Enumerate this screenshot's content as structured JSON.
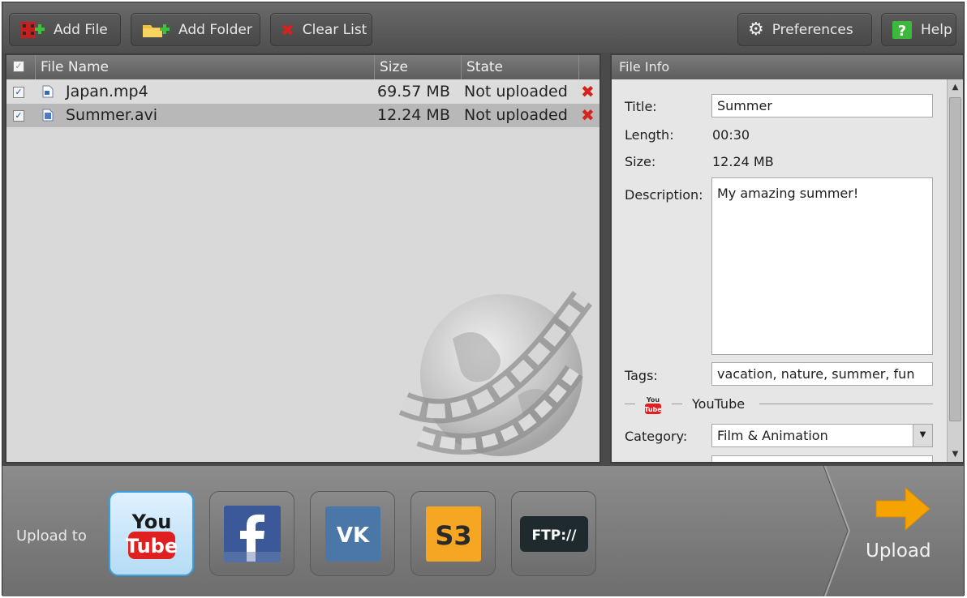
{
  "toolbar": {
    "add_file": "Add File",
    "add_folder": "Add Folder",
    "clear_list": "Clear List",
    "preferences": "Preferences",
    "help": "Help"
  },
  "file_list": {
    "columns": {
      "name": "File Name",
      "size": "Size",
      "state": "State"
    },
    "rows": [
      {
        "name": "Japan.mp4",
        "size": "69.57 MB",
        "state": "Not uploaded",
        "checked": true
      },
      {
        "name": "Summer.avi",
        "size": "12.24 MB",
        "state": "Not uploaded",
        "checked": true
      }
    ]
  },
  "file_info": {
    "header": "File Info",
    "title_label": "Title:",
    "title_value": "Summer",
    "length_label": "Length:",
    "length_value": "00:30",
    "size_label": "Size:",
    "size_value": "12.24 MB",
    "description_label": "Description:",
    "description_value": "My amazing summer!",
    "tags_label": "Tags:",
    "tags_value": "vacation, nature, summer, fun",
    "youtube_section": "YouTube",
    "category_label": "Category:",
    "category_value": "Film & Animation"
  },
  "bottom": {
    "upload_to": "Upload to",
    "services": [
      "youtube-icon",
      "facebook-icon",
      "vk-icon",
      "s3-icon",
      "ftp-icon"
    ],
    "youtube_logo_top": "You",
    "youtube_logo_bottom": "Tube",
    "ftp_label": "FTP://",
    "s3_label": "S3",
    "upload_label": "Upload"
  },
  "colors": {
    "accent_blue": "#3aa0e0",
    "youtube_red": "#e02020",
    "facebook_blue": "#3b5998",
    "vk_blue": "#4a76a8",
    "s3_orange": "#f5a623",
    "ftp_dark": "#1e2a2e",
    "remove_red": "#d8201f",
    "upload_arrow": "#f5a300"
  }
}
